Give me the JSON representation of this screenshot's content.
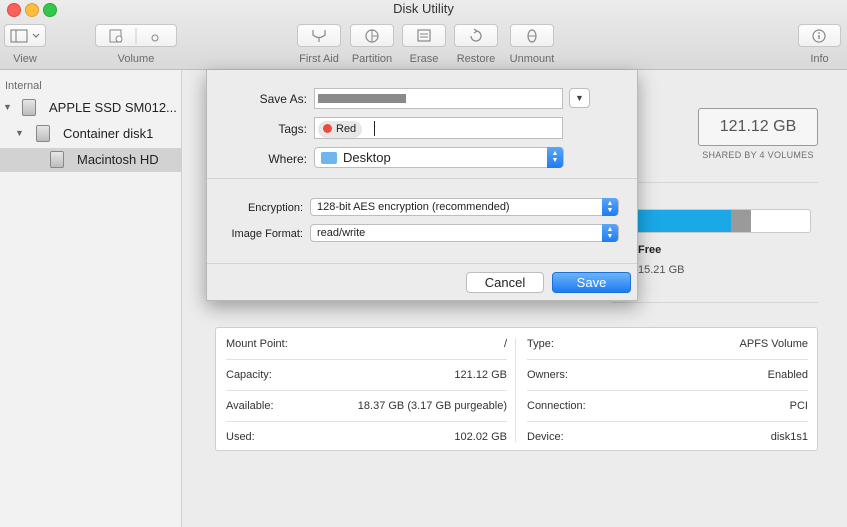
{
  "window": {
    "title": "Disk Utility"
  },
  "toolbar": {
    "view_label": "View",
    "volume_label": "Volume",
    "first_aid_label": "First Aid",
    "partition_label": "Partition",
    "erase_label": "Erase",
    "restore_label": "Restore",
    "unmount_label": "Unmount",
    "info_label": "Info"
  },
  "sidebar": {
    "section": "Internal",
    "items": [
      {
        "label": "APPLE SSD SM012..."
      },
      {
        "label": "Container disk1"
      },
      {
        "label": "Macintosh HD"
      }
    ]
  },
  "volume": {
    "capacity": "121.12 GB",
    "capacity_sub": "SHARED BY 4 VOLUMES",
    "free_label": "Free",
    "free_value": "15.21 GB",
    "usage_fraction": 0.6,
    "purgeable_fraction": 0.1,
    "accent_color": "#1aa8e6"
  },
  "info": {
    "left": [
      {
        "key": "Mount Point:",
        "value": "/"
      },
      {
        "key": "Capacity:",
        "value": "121.12 GB"
      },
      {
        "key": "Available:",
        "value": "18.37 GB (3.17 GB purgeable)"
      },
      {
        "key": "Used:",
        "value": "102.02 GB"
      }
    ],
    "right": [
      {
        "key": "Type:",
        "value": "APFS Volume"
      },
      {
        "key": "Owners:",
        "value": "Enabled"
      },
      {
        "key": "Connection:",
        "value": "PCI"
      },
      {
        "key": "Device:",
        "value": "disk1s1"
      }
    ]
  },
  "save_sheet": {
    "save_as_label": "Save As:",
    "tags_label": "Tags:",
    "tag": "Red",
    "tag_color": "#e74c3c",
    "where_label": "Where:",
    "where_value": "Desktop",
    "encryption_label": "Encryption:",
    "encryption_value": "128-bit AES encryption (recommended)",
    "image_format_label": "Image Format:",
    "image_format_value": "read/write",
    "cancel_label": "Cancel",
    "save_label": "Save"
  }
}
